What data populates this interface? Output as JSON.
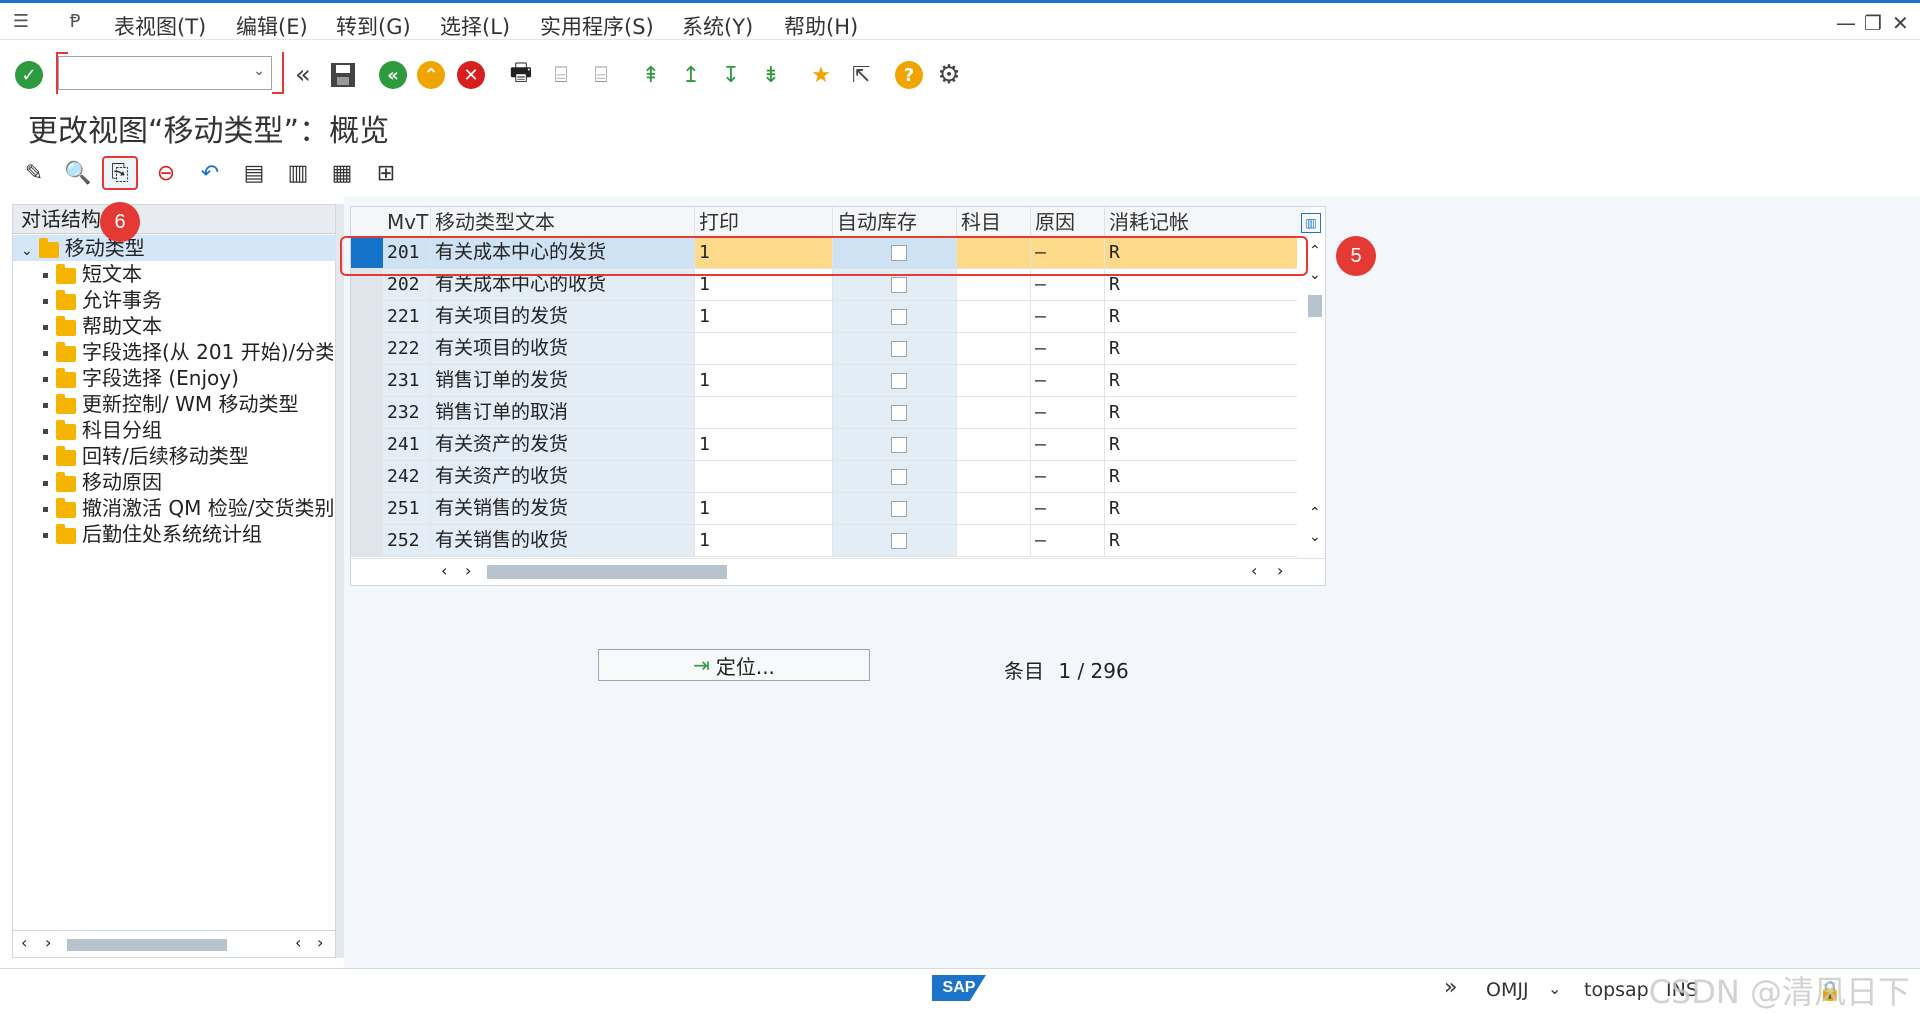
{
  "menubar": {
    "items": [
      "表视图(T)",
      "编辑(E)",
      "转到(G)",
      "选择(L)",
      "实用程序(S)",
      "系统(Y)",
      "帮助(H)"
    ]
  },
  "command_field": {
    "value": ""
  },
  "title": "更改视图“移动类型”：概览",
  "tree": {
    "header": "对话结构",
    "root": "移动类型",
    "children": [
      "短文本",
      "允许事务",
      "帮助文本",
      "字段选择(从 201 开始)/分类",
      "字段选择 (Enjoy)",
      "更新控制/ WM 移动类型",
      "科目分组",
      "回转/后续移动类型",
      "移动原因",
      "撤消激活 QM 检验/交货类别",
      "后勤住处系统统计组"
    ]
  },
  "table": {
    "columns": [
      "MvT",
      "移动类型文本",
      "打印",
      "自动库存",
      "科目",
      "原因",
      "消耗记帐"
    ],
    "rows": [
      {
        "mvt": "201",
        "text": "有关成本中心的发货",
        "print": "1",
        "auto": "",
        "acct": "",
        "reason": "–",
        "cons": "R"
      },
      {
        "mvt": "202",
        "text": "有关成本中心的收货",
        "print": "1",
        "auto": "",
        "acct": "",
        "reason": "–",
        "cons": "R"
      },
      {
        "mvt": "221",
        "text": "有关项目的发货",
        "print": "1",
        "auto": "",
        "acct": "",
        "reason": "–",
        "cons": "R"
      },
      {
        "mvt": "222",
        "text": "有关项目的收货",
        "print": "",
        "auto": "",
        "acct": "",
        "reason": "–",
        "cons": "R"
      },
      {
        "mvt": "231",
        "text": "销售订单的发货",
        "print": "1",
        "auto": "",
        "acct": "",
        "reason": "–",
        "cons": "R"
      },
      {
        "mvt": "232",
        "text": "销售订单的取消",
        "print": "",
        "auto": "",
        "acct": "",
        "reason": "–",
        "cons": "R"
      },
      {
        "mvt": "241",
        "text": "有关资产的发货",
        "print": "1",
        "auto": "",
        "acct": "",
        "reason": "–",
        "cons": "R"
      },
      {
        "mvt": "242",
        "text": "有关资产的收货",
        "print": "",
        "auto": "",
        "acct": "",
        "reason": "–",
        "cons": "R"
      },
      {
        "mvt": "251",
        "text": "有关销售的发货",
        "print": "1",
        "auto": "",
        "acct": "",
        "reason": "–",
        "cons": "R"
      },
      {
        "mvt": "252",
        "text": "有关销售的收货",
        "print": "1",
        "auto": "",
        "acct": "",
        "reason": "–",
        "cons": "R"
      }
    ]
  },
  "position_button": "定位...",
  "entries": {
    "label": "条目",
    "value": "1 / 296"
  },
  "badges": {
    "a": "5",
    "b": "6"
  },
  "status": {
    "tcode": "OMJJ",
    "server": "topsap",
    "mode": "INS"
  },
  "watermark": "CSDN @清风日下",
  "colors": {
    "accent": "#1b74c9",
    "selected_row": "#fdd98a",
    "highlight": "#e53935"
  }
}
